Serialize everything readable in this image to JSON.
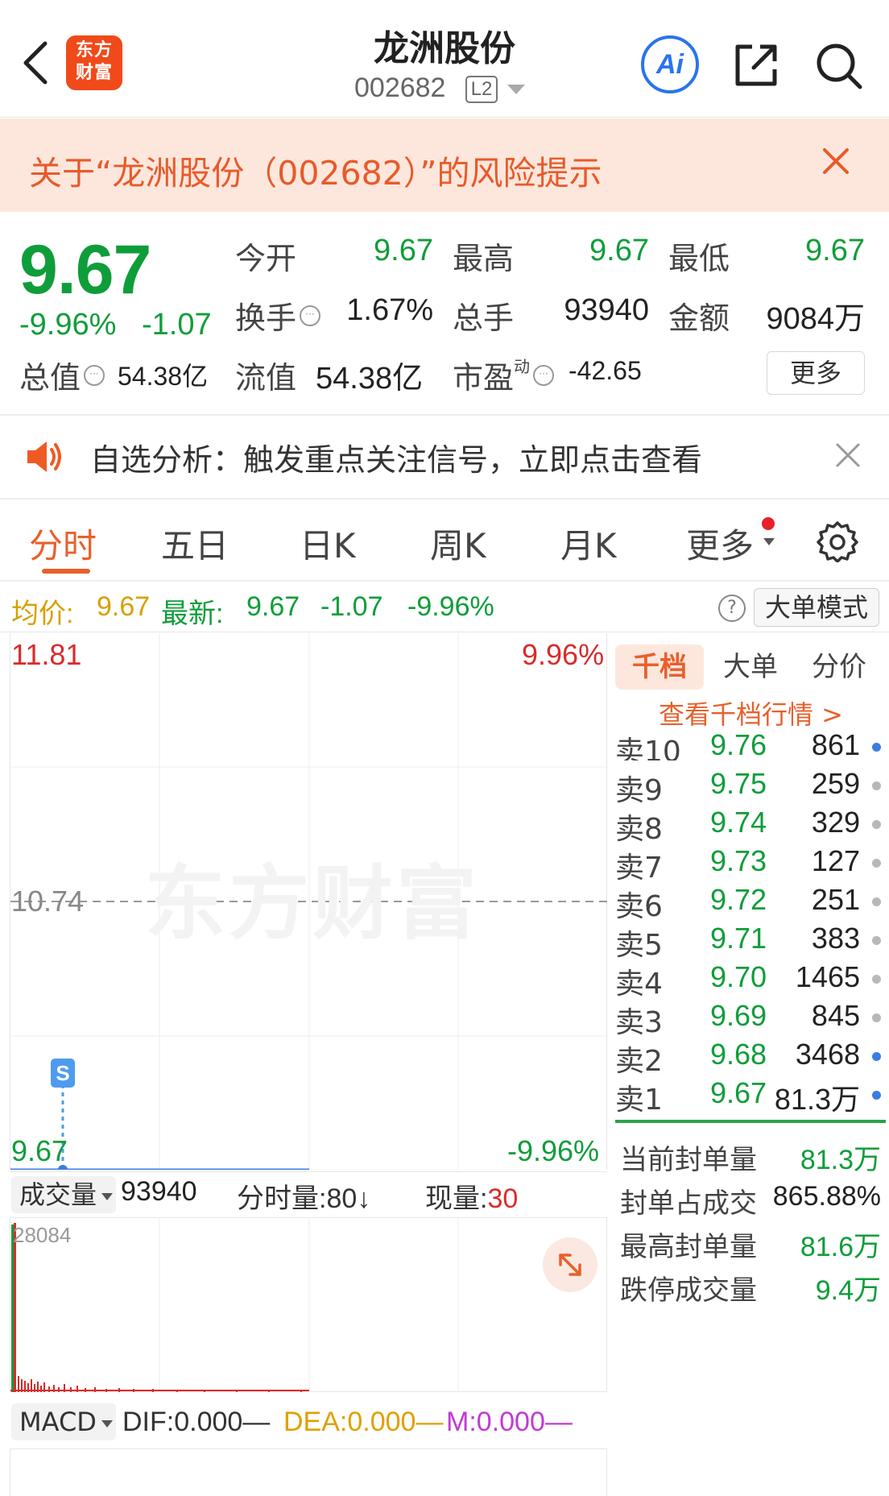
{
  "header": {
    "logo_text": "东方财富",
    "stock_name": "龙洲股份",
    "stock_code": "002682",
    "level_badge": "L2",
    "ai_label": "Ai"
  },
  "risk_banner": {
    "text": "关于“龙洲股份（002682）”的风险提示"
  },
  "quote": {
    "price": "9.67",
    "change_pct": "-9.96%",
    "change_abs": "-1.07",
    "open_label": "今开",
    "open_value": "9.67",
    "high_label": "最高",
    "high_value": "9.67",
    "low_label": "最低",
    "low_value": "9.67",
    "turnover_label": "换手",
    "turnover_value": "1.67%",
    "volume_label": "总手",
    "volume_value": "93940",
    "amount_label": "金额",
    "amount_value": "9084万",
    "mcap_label": "总值",
    "mcap_value": "54.38亿",
    "float_label": "流值",
    "float_value": "54.38亿",
    "pe_label": "市盈",
    "pe_sup": "动",
    "pe_value": "-42.65",
    "more_label": "更多"
  },
  "analysis": {
    "text": "自选分析：触发重点关注信号，立即点击查看"
  },
  "tabs": [
    {
      "label": "分时"
    },
    {
      "label": "五日"
    },
    {
      "label": "日K"
    },
    {
      "label": "周K"
    },
    {
      "label": "月K"
    },
    {
      "label": "更多"
    }
  ],
  "info_line": {
    "avg_label": "均价:",
    "avg_value": "9.67",
    "latest_label": "最新:",
    "latest_value": "9.67",
    "chg_abs": "-1.07",
    "chg_pct": "-9.96%",
    "mode_label": "大单模式",
    "help_icon": "?"
  },
  "chart": {
    "price_top": "11.81",
    "price_mid": "10.74",
    "price_bottom": "9.67",
    "pct_top": "9.96%",
    "pct_bottom": "-9.96%",
    "marker": "S",
    "watermark": "东方财富",
    "colors": {
      "up": "#d92b2b",
      "down": "#0f9d3a",
      "line": "#3b7de0",
      "marker": "#4f9bef"
    }
  },
  "volume": {
    "selector": "成交量",
    "total": "93940",
    "per_minute_label": "分时量:",
    "per_minute_value": "80",
    "per_minute_arrow": "↓",
    "current_label": "现量:",
    "current_value": "30",
    "axis_max": "28084"
  },
  "macd": {
    "selector": "MACD",
    "dif": "DIF:0.000—",
    "dea": "DEA:0.000—",
    "m": "M:0.000—"
  },
  "order_book": {
    "tabs": [
      "千档",
      "大单",
      "分价"
    ],
    "link": "查看千档行情 >",
    "rows": [
      {
        "name": "卖10",
        "price": "9.76",
        "vol": "861",
        "dot": "blue"
      },
      {
        "name": "卖9",
        "price": "9.75",
        "vol": "259",
        "dot": "gray"
      },
      {
        "name": "卖8",
        "price": "9.74",
        "vol": "329",
        "dot": "gray"
      },
      {
        "name": "卖7",
        "price": "9.73",
        "vol": "127",
        "dot": "gray"
      },
      {
        "name": "卖6",
        "price": "9.72",
        "vol": "251",
        "dot": "gray"
      },
      {
        "name": "卖5",
        "price": "9.71",
        "vol": "383",
        "dot": "gray"
      },
      {
        "name": "卖4",
        "price": "9.70",
        "vol": "1465",
        "dot": "gray"
      },
      {
        "name": "卖3",
        "price": "9.69",
        "vol": "845",
        "dot": "gray"
      },
      {
        "name": "卖2",
        "price": "9.68",
        "vol": "3468",
        "dot": "blue"
      },
      {
        "name": "卖1",
        "price": "9.67",
        "vol": "81.3万",
        "dot": "blue"
      }
    ],
    "seal": [
      {
        "label": "当前封单量",
        "value": "81.3万",
        "color": "green"
      },
      {
        "label": "封单占成交",
        "value": "865.88%",
        "color": "black"
      },
      {
        "label": "最高封单量",
        "value": "81.6万",
        "color": "green"
      },
      {
        "label": "跌停成交量",
        "value": "9.4万",
        "color": "green"
      }
    ]
  }
}
